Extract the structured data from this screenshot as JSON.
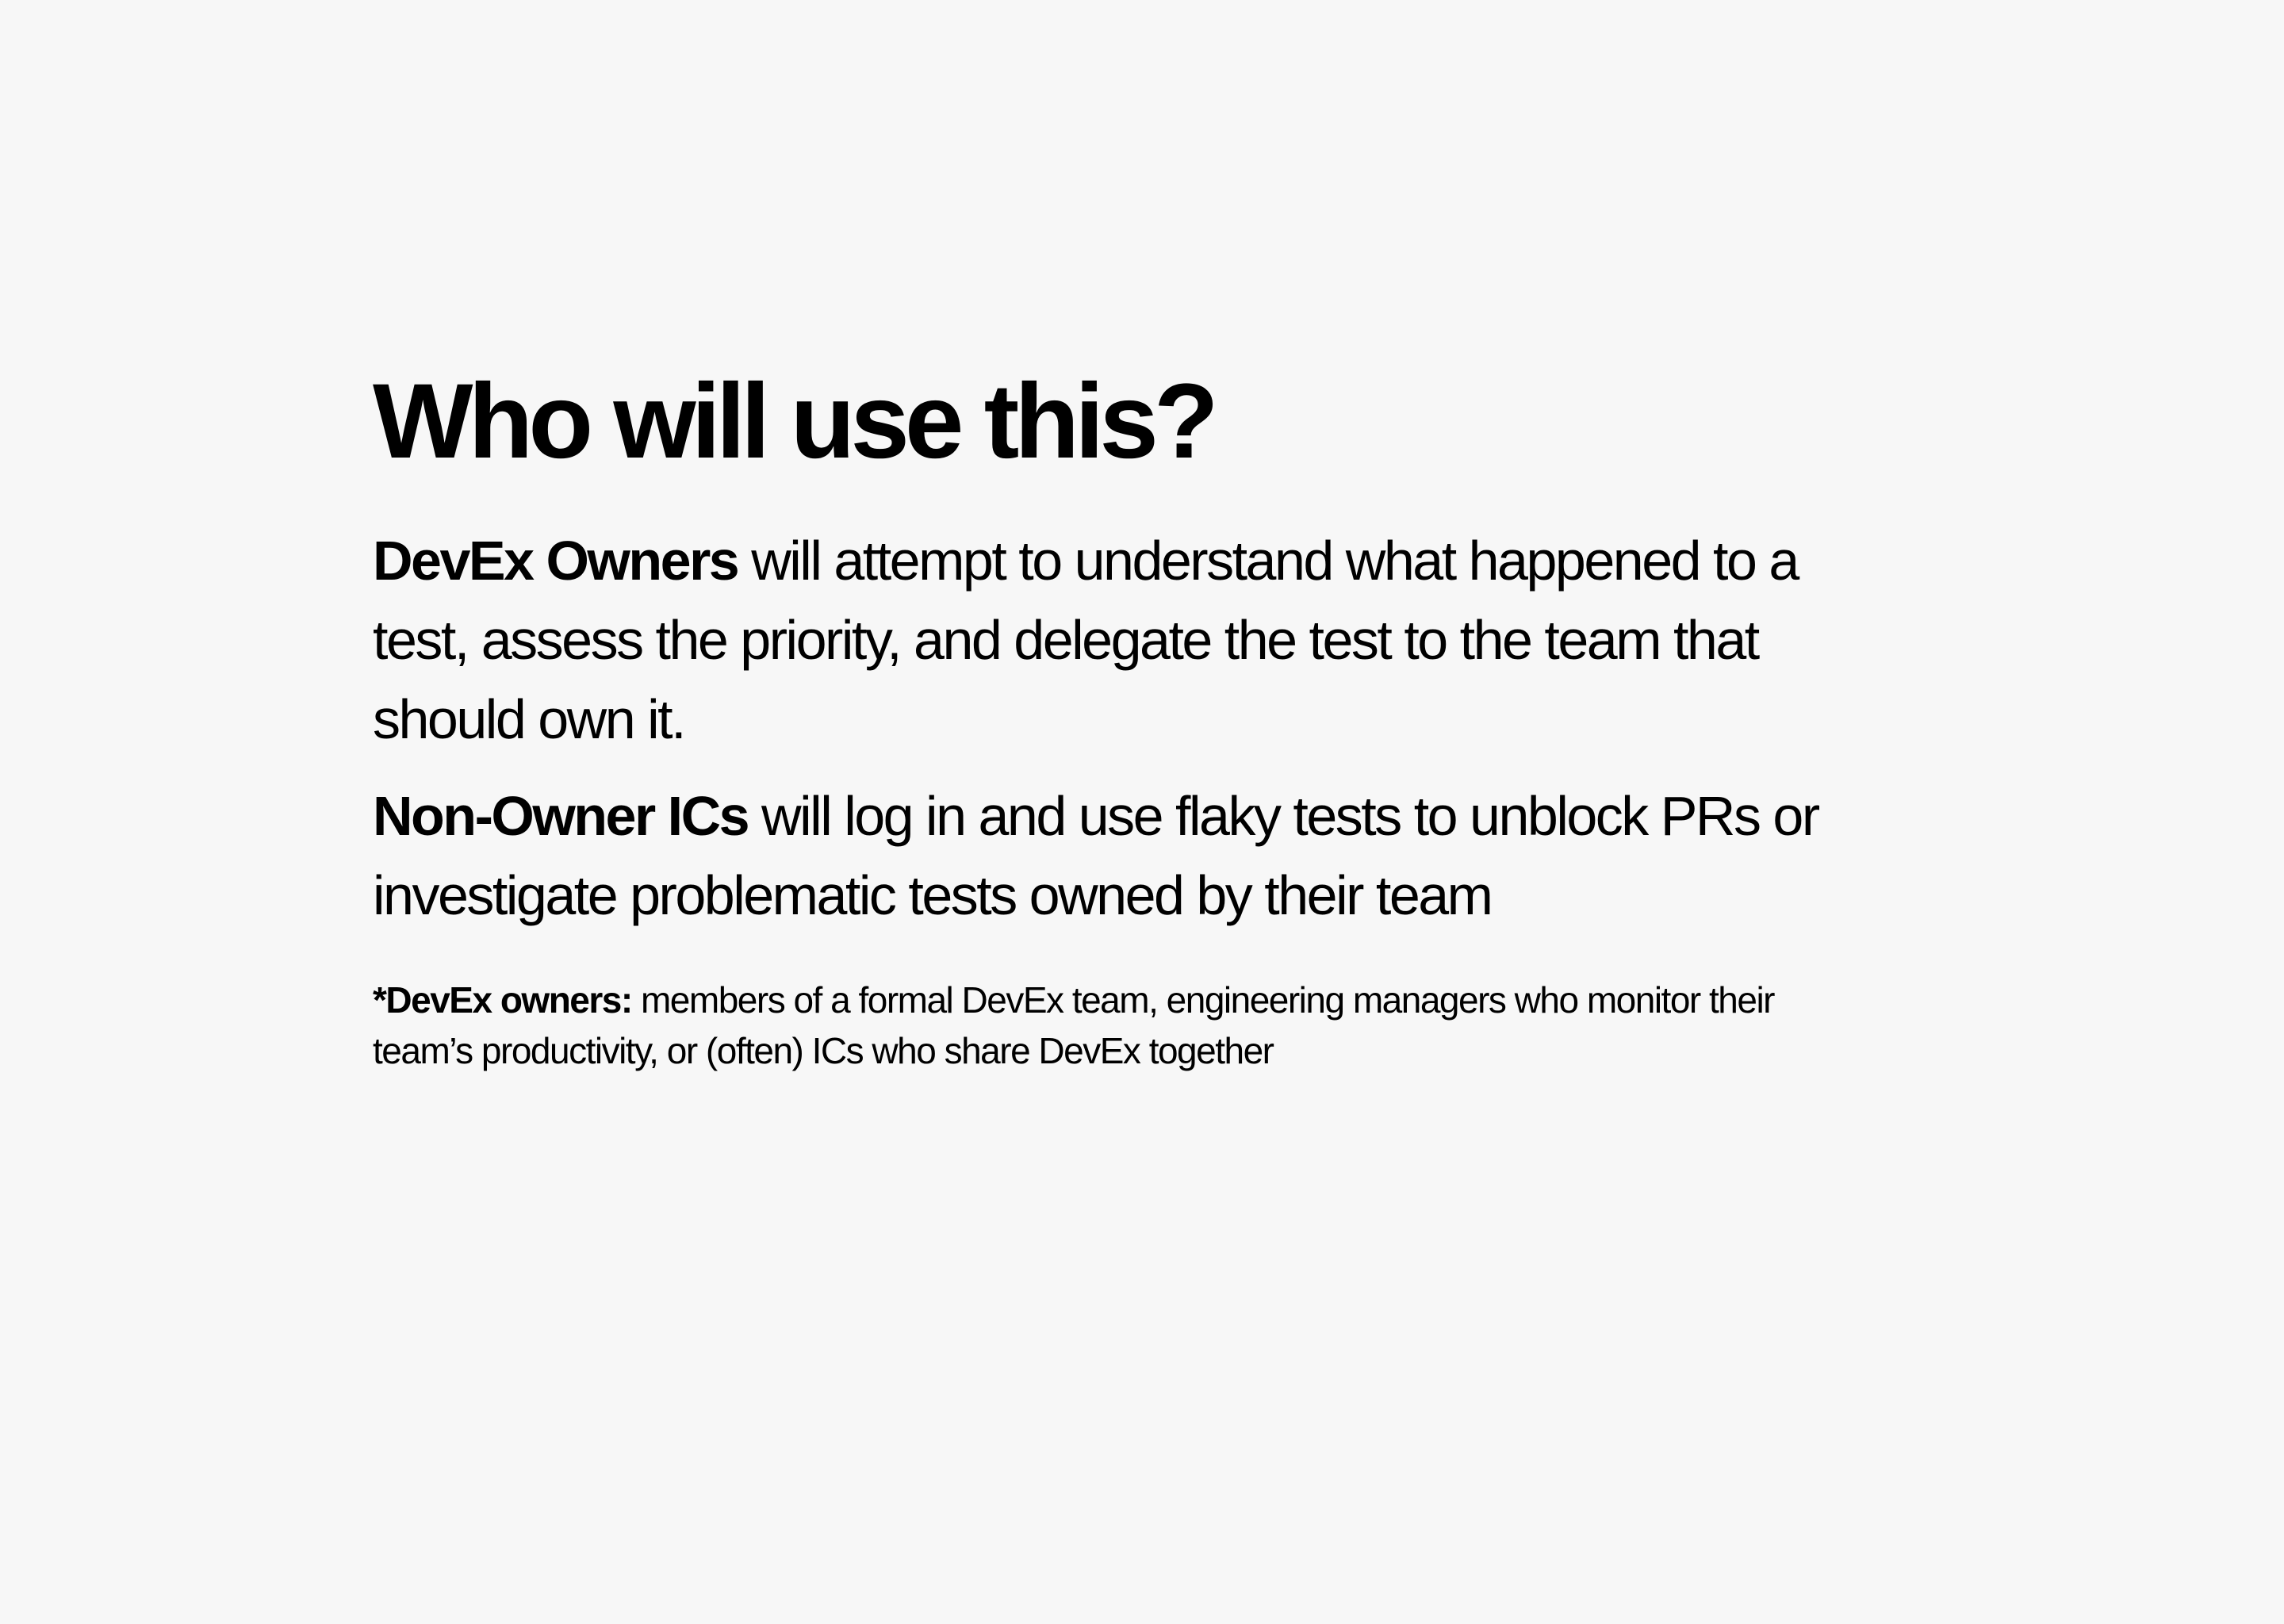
{
  "title": "Who will use this?",
  "paragraph_1": {
    "label": "DevEx Owners",
    "text": " will attempt to understand what happened to a test, assess the priority, and delegate the test to the team that should own it."
  },
  "paragraph_2": {
    "label": "Non-Owner ICs",
    "text": " will log in and use flaky tests to unblock PRs or investigate problematic tests owned by their team"
  },
  "footnote": {
    "label": "*DevEx owners:",
    "text": " members of a formal DevEx team, engineering managers who monitor their team’s productivity, or (often) ICs who share DevEx together"
  }
}
